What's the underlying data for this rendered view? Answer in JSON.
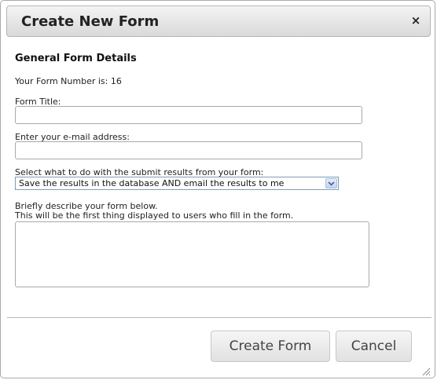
{
  "dialog": {
    "title": "Create New Form",
    "close_label": "×"
  },
  "form": {
    "section_heading": "General Form Details",
    "form_number_text": "Your Form Number is: 16",
    "title_label": "Form Title:",
    "title_value": "",
    "email_label": "Enter your e-mail address:",
    "email_value": "",
    "results_label": "Select what to do with the submit results from your form:",
    "results_selected": "Save the results in the database AND email the results to me",
    "description_label_line1": "Briefly describe your form below.",
    "description_label_line2": "This will be the first thing displayed to users who fill in the form.",
    "description_value": ""
  },
  "footer": {
    "create_label": "Create Form",
    "cancel_label": "Cancel"
  },
  "icons": {
    "close": "close-icon",
    "dropdown": "chevron-down-icon",
    "resize": "resize-grip-icon"
  },
  "colors": {
    "select_border": "#7f9db9",
    "select_arrow": "#4d6185"
  }
}
